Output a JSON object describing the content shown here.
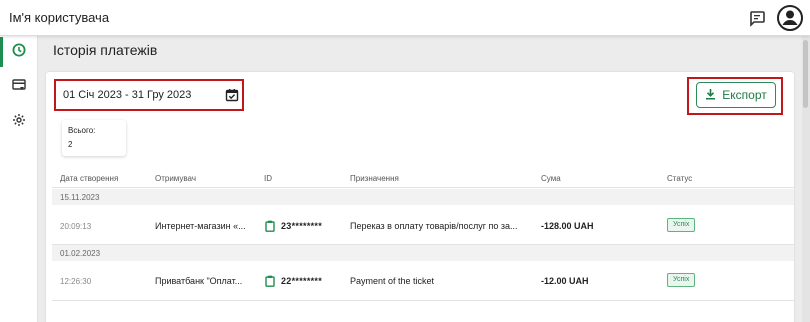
{
  "header": {
    "username": "Ім'я користувача",
    "chat_icon": "chat-icon",
    "account_icon": "account-circle-icon"
  },
  "sidebar": {
    "items": [
      {
        "icon": "history-icon",
        "active": true
      },
      {
        "icon": "card-list-icon",
        "active": false
      },
      {
        "icon": "gear-icon",
        "active": false
      }
    ]
  },
  "page": {
    "title": "Історія платежів"
  },
  "filters": {
    "date_range": "01 Січ 2023 - 31 Гру 2023",
    "calendar_icon": "calendar-check-icon"
  },
  "export": {
    "label": "Експорт",
    "icon": "download-icon"
  },
  "summary": {
    "total_label": "Всього:",
    "total_value": "2"
  },
  "table": {
    "columns": [
      "Дата створення",
      "Отримувач",
      "ID",
      "Призначення",
      "Сума",
      "Статус"
    ],
    "groups": [
      {
        "date": "15.11.2023",
        "rows": [
          {
            "time": "20:09:13",
            "recipient": "Интернет-магазин «...",
            "id": "23********",
            "purpose": "Переказ в оплату товарів/послуг по за...",
            "sum": "-128.00 UAH",
            "status": "Успіх"
          }
        ]
      },
      {
        "date": "01.02.2023",
        "rows": [
          {
            "time": "12:26:30",
            "recipient": "Приватбанк \"Оплат...",
            "id": "22********",
            "purpose": "Payment of the ticket",
            "sum": "-12.00 UAH",
            "status": "Успіх"
          }
        ]
      }
    ]
  },
  "colors": {
    "accent": "#1e8e4f",
    "highlight": "#c0161c",
    "status_bg": "#e9f6ee"
  }
}
